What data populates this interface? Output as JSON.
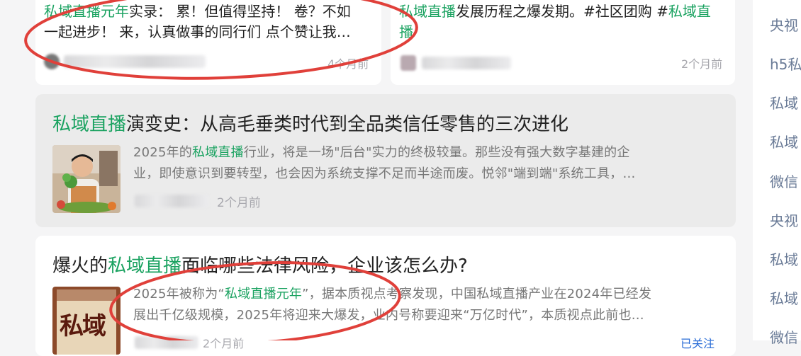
{
  "cards": {
    "top_left": {
      "text_highlight": "私域直播元年",
      "text_rest_line1": "实录： 累！但值得坚持！ 卷？不如",
      "text_line2": "一起进步！ 来，认真做事的同行们 点个赞让我…",
      "time": "4个月前"
    },
    "top_right": {
      "text_highlight1": "私域直播",
      "text_rest_line1": "发展历程之爆发期。#社区团购 #",
      "text_highlight2": "私域直",
      "text_highlight3": "播",
      "time": "2个月前"
    },
    "middle": {
      "title_highlight": "私域直播",
      "title_rest": "演变史：从高毛垂类时代到全品类信任零售的三次进化",
      "summary_line1_a": "2025年的",
      "summary_line1_hl": "私域直播",
      "summary_line1_b": "行业，将是一场\"后台\"实力的终极较量。那些没有强大数字基建的企",
      "summary_line2": "业，即使意识到要转型，也会因为系统支撑不足而半途而废。悦邻\"端到端\"系统工具，…",
      "time": "2个月前"
    },
    "bottom": {
      "title_a": "爆火的",
      "title_hl": "私域直播",
      "title_b": "面临哪些法律风险，企业该怎么办?",
      "summary_line1_a": "2025年被称为“",
      "summary_line1_hl": "私域直播元年",
      "summary_line1_b": "”，据本质视点考察发现，中国私域直播产业在2024年已经发",
      "summary_line2": "展出千亿级规模，2025年将迎来大爆发，业内号称要迎来“万亿时代”，本质视点此前也…",
      "thumb_text": "私域",
      "time": "2个月前",
      "follow": "已关注"
    }
  },
  "sidebar": {
    "items": [
      "央视",
      "h5私",
      "私域",
      "私域",
      "微信",
      "央视",
      "私域",
      "私域",
      "微信"
    ]
  },
  "colors": {
    "highlight": "#1aa260",
    "annotation_circle": "#e0403a",
    "sidebar_text": "#697a96"
  }
}
